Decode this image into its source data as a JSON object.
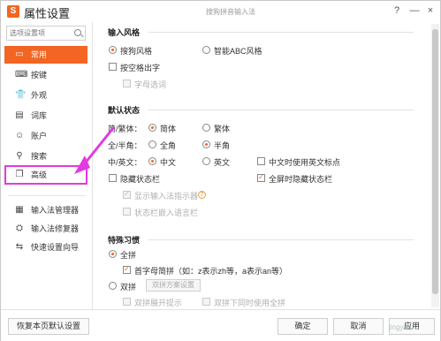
{
  "window": {
    "title": "属性设置",
    "center_title": "搜狗拼音输入法",
    "logo_text": "S"
  },
  "title_buttons": {
    "help": "?",
    "minimize": "—",
    "close": "×"
  },
  "sidebar": {
    "search_placeholder": "选项设置项",
    "items": [
      {
        "label": "常用",
        "icon": "monitor-icon"
      },
      {
        "label": "按键",
        "icon": "keyboard-icon"
      },
      {
        "label": "外观",
        "icon": "shirt-icon"
      },
      {
        "label": "词库",
        "icon": "book-icon"
      },
      {
        "label": "账户",
        "icon": "user-icon"
      },
      {
        "label": "搜索",
        "icon": "search-icon"
      },
      {
        "label": "高级",
        "icon": "copy-icon"
      }
    ],
    "tools": [
      {
        "label": "输入法管理器",
        "icon": "manager-icon"
      },
      {
        "label": "输入法修复器",
        "icon": "repair-icon"
      },
      {
        "label": "快速设置向导",
        "icon": "wizard-icon"
      }
    ]
  },
  "sections": {
    "input_style": {
      "title": "输入风格",
      "opt1": "搜狗风格",
      "opt2": "智能ABC风格",
      "check1": "按空格出字",
      "check2": "字母选词"
    },
    "default_state": {
      "title": "默认状态",
      "row1_label": "简/繁体：",
      "row1_opt1": "简体",
      "row1_opt2": "繁体",
      "row2_label": "全/半角：",
      "row2_opt1": "全角",
      "row2_opt2": "半角",
      "row3_label": "中/英文：",
      "row3_opt1": "中文",
      "row3_opt2": "英文",
      "row3_check": "中文时使用英文标点",
      "check_hide_status": "隐藏状态栏",
      "check_fullscreen_hide": "全屏时隐藏状态栏",
      "check_show_indicator": "显示输入法指示器",
      "check_embed_lang": "状态栏嵌入语言栏"
    },
    "special_habits": {
      "title": "特殊习惯",
      "opt_full": "全拼",
      "check_initials": "首字母简拼（如：z表示zh等，a表示an等）",
      "opt_double": "双拼",
      "btn_double_scheme": "双拼方案设置",
      "check_double_expand": "双拼展开提示",
      "check_double_full": "双拼下同时使用全拼"
    }
  },
  "buttons": {
    "restore": "恢复本页默认设置",
    "ok": "确定",
    "cancel": "取消",
    "apply": "应用"
  },
  "watermark": "jingyan"
}
